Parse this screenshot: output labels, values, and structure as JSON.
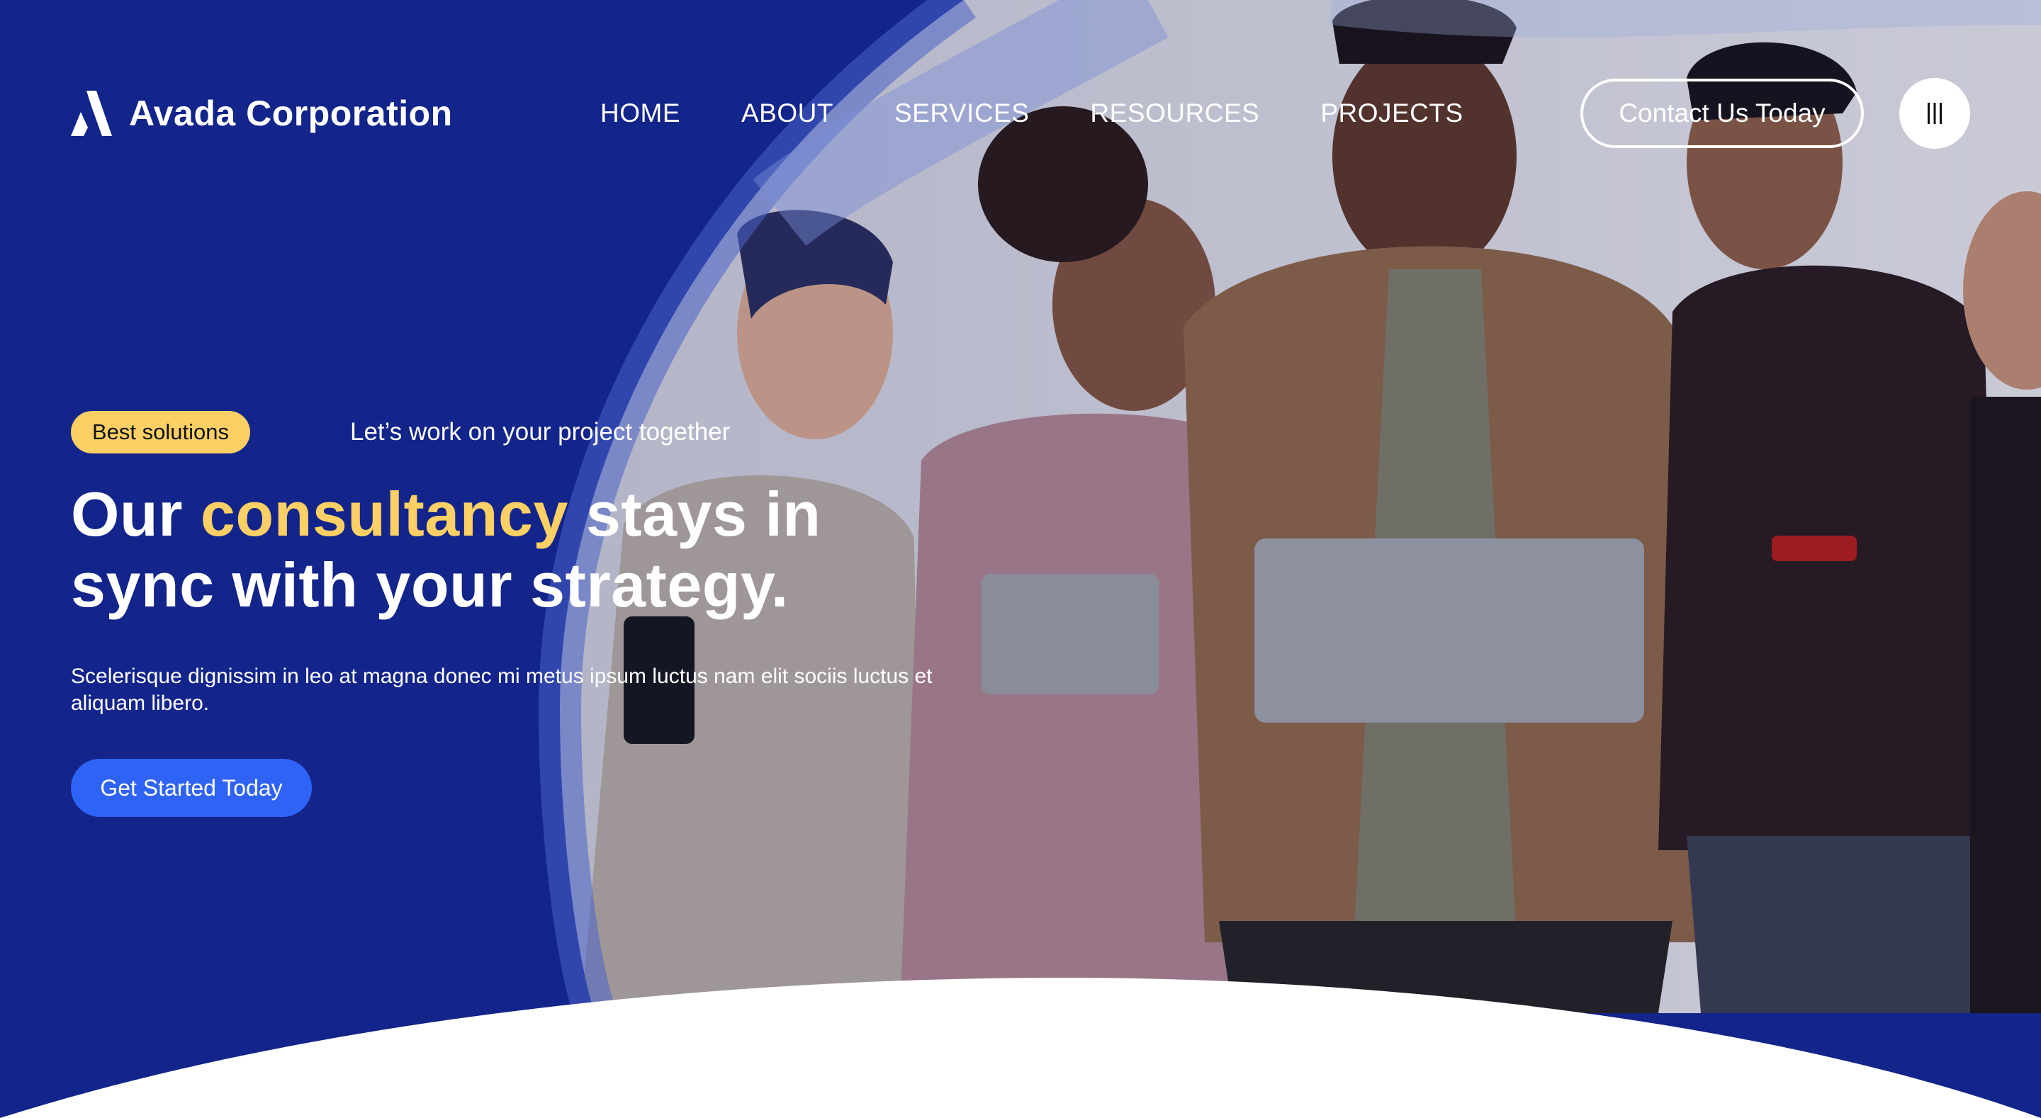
{
  "brand": {
    "name": "Avada Corporation",
    "logo_icon": "avada-logo-icon"
  },
  "nav": {
    "items": [
      {
        "label": "HOME"
      },
      {
        "label": "ABOUT"
      },
      {
        "label": "SERVICES"
      },
      {
        "label": "RESOURCES"
      },
      {
        "label": "PROJECTS"
      }
    ],
    "contact_label": "Contact Us Today",
    "menu_icon": "hamburger-bars-icon"
  },
  "hero": {
    "badge": "Best solutions",
    "tagline": "Let’s work on your project together",
    "headline_pre": "Our ",
    "headline_accent": "consultancy",
    "headline_post": " stays in sync with your strategy.",
    "description": "Scelerisque dignissim in leo at magna donec mi metus ipsum luctus nam elit sociis luctus et aliquam libero.",
    "cta_label": "Get Started Today"
  },
  "colors": {
    "background": "#13248a",
    "accent": "#fcd064",
    "button": "#2e63f5",
    "white": "#ffffff"
  }
}
